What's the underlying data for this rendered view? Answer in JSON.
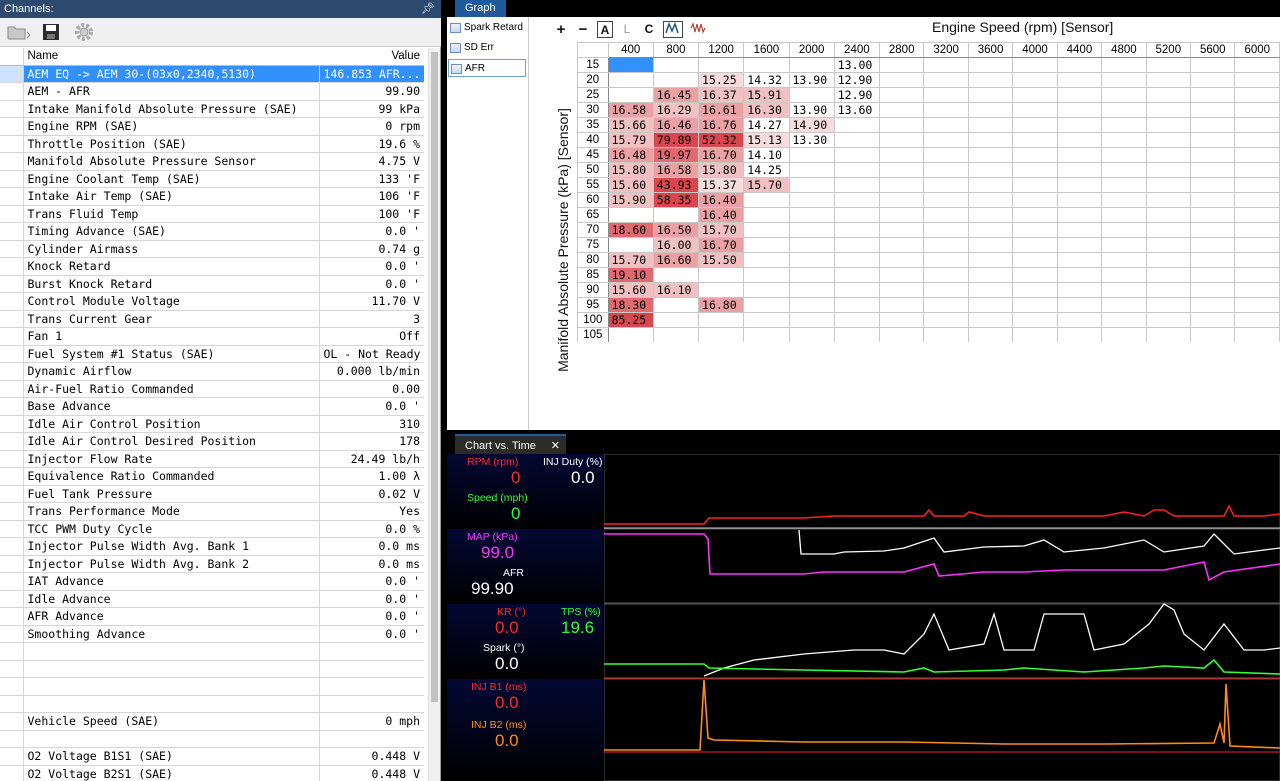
{
  "channels": {
    "title": "Channels:",
    "pin_icon": "pin-icon",
    "col_name": "Name",
    "col_value": "Value",
    "rows": [
      {
        "name": "AEM EQ -> AEM 30-(03x0,2340,5130)",
        "value": "146.853 AFR..."
      },
      {
        "name": "AEM - AFR",
        "value": "99.90"
      },
      {
        "name": "Intake Manifold Absolute Pressure (SAE)",
        "value": "99 kPa"
      },
      {
        "name": "Engine RPM (SAE)",
        "value": "0 rpm"
      },
      {
        "name": "Throttle Position (SAE)",
        "value": "19.6 %"
      },
      {
        "name": "Manifold Absolute Pressure Sensor",
        "value": "4.75 V"
      },
      {
        "name": "Engine Coolant Temp (SAE)",
        "value": "133 'F"
      },
      {
        "name": "Intake Air Temp (SAE)",
        "value": "106 'F"
      },
      {
        "name": "Trans Fluid Temp",
        "value": "100 'F"
      },
      {
        "name": "Timing Advance (SAE)",
        "value": "0.0 '"
      },
      {
        "name": "Cylinder Airmass",
        "value": "0.74 g"
      },
      {
        "name": "Knock Retard",
        "value": "0.0 '"
      },
      {
        "name": "Burst Knock Retard",
        "value": "0.0 '"
      },
      {
        "name": "Control Module Voltage",
        "value": "11.70 V"
      },
      {
        "name": "Trans Current Gear",
        "value": "3"
      },
      {
        "name": "Fan 1",
        "value": "Off"
      },
      {
        "name": "Fuel System #1 Status (SAE)",
        "value": "OL - Not Ready"
      },
      {
        "name": "Dynamic Airflow",
        "value": "0.000 lb/min"
      },
      {
        "name": "Air-Fuel Ratio Commanded",
        "value": "0.00"
      },
      {
        "name": "Base Advance",
        "value": "0.0 '"
      },
      {
        "name": "Idle Air Control Position",
        "value": "310"
      },
      {
        "name": "Idle Air Control Desired Position",
        "value": "178"
      },
      {
        "name": "Injector Flow Rate",
        "value": "24.49 lb/h"
      },
      {
        "name": "Equivalence Ratio Commanded",
        "value": "1.00 λ"
      },
      {
        "name": "Fuel Tank Pressure",
        "value": "0.02 V"
      },
      {
        "name": "Trans Performance Mode",
        "value": "Yes"
      },
      {
        "name": "TCC PWM Duty Cycle",
        "value": "0.0 %"
      },
      {
        "name": "Injector Pulse Width Avg. Bank 1",
        "value": "0.0 ms"
      },
      {
        "name": "Injector Pulse Width Avg. Bank 2",
        "value": "0.0 ms"
      },
      {
        "name": "IAT Advance",
        "value": "0.0 '"
      },
      {
        "name": "Idle Advance",
        "value": "0.0 '"
      },
      {
        "name": "AFR Advance",
        "value": "0.0 '"
      },
      {
        "name": "Smoothing Advance",
        "value": "0.0 '"
      },
      {
        "name": "",
        "value": ""
      },
      {
        "name": "",
        "value": ""
      },
      {
        "name": "",
        "value": ""
      },
      {
        "name": "",
        "value": ""
      },
      {
        "name": "Vehicle Speed (SAE)",
        "value": "0 mph"
      },
      {
        "name": "",
        "value": ""
      },
      {
        "name": "O2 Voltage B1S1 (SAE)",
        "value": "0.448 V"
      },
      {
        "name": "O2 Voltage B2S1 (SAE)",
        "value": "0.448 V"
      }
    ]
  },
  "graph": {
    "tab": "Graph",
    "side_items": [
      "Spark Retard",
      "SD Err",
      "AFR"
    ],
    "toolbar": {
      "plus": "+",
      "minus": "−",
      "a": "A",
      "l": "L",
      "c": "C"
    },
    "x_title": "Engine Speed (rpm) [Sensor]",
    "y_title": "Manifold Absolute Pressure (kPa) [Sensor]",
    "x_headers": [
      "400",
      "800",
      "1200",
      "1600",
      "2000",
      "2400",
      "2800",
      "3200",
      "3600",
      "4000",
      "4400",
      "4800",
      "5200",
      "5600",
      "6000"
    ],
    "y_headers": [
      "15",
      "20",
      "25",
      "30",
      "35",
      "40",
      "45",
      "50",
      "55",
      "60",
      "65",
      "70",
      "75",
      "80",
      "85",
      "90",
      "95",
      "100",
      "105"
    ],
    "cells": [
      [
        "",
        "",
        "",
        "",
        "",
        "13.00"
      ],
      [
        "",
        "",
        "15.25",
        "14.32",
        "13.90",
        "12.90"
      ],
      [
        "",
        "16.45",
        "16.37",
        "15.91",
        "",
        "12.90"
      ],
      [
        "16.58",
        "16.29",
        "16.61",
        "16.30",
        "13.90",
        "13.60"
      ],
      [
        "15.66",
        "16.46",
        "16.76",
        "14.27",
        "14.90",
        ""
      ],
      [
        "15.79",
        "79.89",
        "52.32",
        "15.13",
        "13.30",
        ""
      ],
      [
        "16.48",
        "19.97",
        "16.70",
        "14.10",
        "",
        ""
      ],
      [
        "15.80",
        "16.58",
        "15.80",
        "14.25",
        "",
        ""
      ],
      [
        "15.60",
        "43.93",
        "15.37",
        "15.70",
        "",
        ""
      ],
      [
        "15.90",
        "58.35",
        "16.40",
        "",
        "",
        ""
      ],
      [
        "",
        "",
        "16.40",
        "",
        "",
        ""
      ],
      [
        "18.60",
        "16.50",
        "15.70",
        "",
        "",
        ""
      ],
      [
        "",
        "16.00",
        "16.70",
        "",
        "",
        ""
      ],
      [
        "15.70",
        "16.60",
        "15.50",
        "",
        "",
        ""
      ],
      [
        "19.10",
        "",
        "",
        "",
        "",
        ""
      ],
      [
        "15.60",
        "16.10",
        "",
        "",
        "",
        ""
      ],
      [
        "18.30",
        "",
        "16.80",
        "",
        "",
        ""
      ],
      [
        "85.25",
        "",
        "",
        "",
        "",
        ""
      ],
      [
        "",
        "",
        "",
        "",
        "",
        ""
      ]
    ]
  },
  "chart": {
    "tab": "Chart vs. Time",
    "close": "✕",
    "panels": [
      {
        "labels": [
          {
            "text": "RPM (rpm)",
            "color": "#ff2a2a"
          },
          {
            "text": "INJ Duty (%)",
            "color": "#ffffff"
          },
          {
            "text": "Speed (mph)",
            "color": "#33ff33"
          }
        ],
        "values": [
          {
            "text": "0",
            "color": "#ff2a2a"
          },
          {
            "text": "0.0",
            "color": "#ffffff"
          },
          {
            "text": "0",
            "color": "#33ff33"
          }
        ]
      },
      {
        "labels": [
          {
            "text": "MAP (kPa)",
            "color": "#ff33ff"
          },
          {
            "text": "AFR",
            "color": "#ffffff"
          }
        ],
        "values": [
          {
            "text": "99.0",
            "color": "#ff33ff"
          },
          {
            "text": "99.90",
            "color": "#ffffff"
          }
        ]
      },
      {
        "labels": [
          {
            "text": "KR (°)",
            "color": "#ff2a2a"
          },
          {
            "text": "TPS (%)",
            "color": "#33ff33"
          },
          {
            "text": "Spark (°)",
            "color": "#ffffff"
          }
        ],
        "values": [
          {
            "text": "0.0",
            "color": "#ff2a2a"
          },
          {
            "text": "19.6",
            "color": "#33ff33"
          },
          {
            "text": "0.0",
            "color": "#ffffff"
          }
        ]
      },
      {
        "labels": [
          {
            "text": "INJ B1 (ms)",
            "color": "#ff2a2a"
          },
          {
            "text": "INJ B2 (ms)",
            "color": "#ff8c1a"
          }
        ],
        "values": [
          {
            "text": "0.0",
            "color": "#ff2a2a"
          },
          {
            "text": "0.0",
            "color": "#ff8c1a"
          }
        ]
      }
    ]
  }
}
